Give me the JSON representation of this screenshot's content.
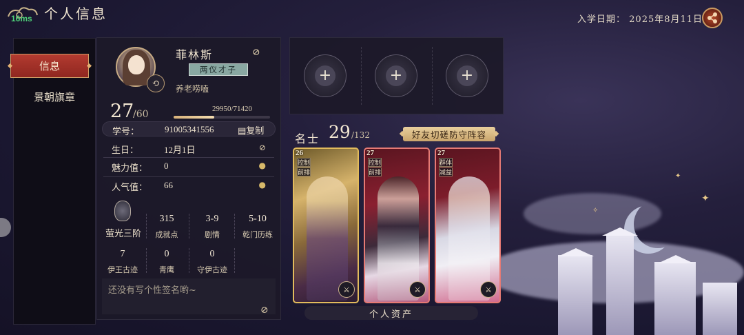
{
  "header": {
    "title": "个人信息",
    "watermark": "16ms",
    "enroll_label": "入学日期：",
    "enroll_date": "2025年8月11日"
  },
  "nav": {
    "items": [
      {
        "label": "信息",
        "active": true
      },
      {
        "label": "景朝旗章",
        "active": false
      }
    ]
  },
  "profile": {
    "name": "菲林斯",
    "title_badge": "两仪才子",
    "tag": "养老唠嗑",
    "level": "27",
    "level_max": "/60",
    "exp_text": "29950/71420",
    "exp_fraction": 0.419,
    "id_label": "学号：",
    "id_value": "91005341556",
    "copy_label": "复制",
    "birthday_label": "生日：",
    "birthday_value": "12月1日",
    "charm_label": "魅力值：",
    "charm_value": "0",
    "popularity_label": "人气值：",
    "popularity_value": "66"
  },
  "stats": {
    "rank": "萤光三阶",
    "items": [
      {
        "value": "315",
        "label": "成就点"
      },
      {
        "value": "3-9",
        "label": "剧情"
      },
      {
        "value": "5-10",
        "label": "乾门历练"
      },
      {
        "value": "7",
        "label": "伊王古迹"
      },
      {
        "value": "0",
        "label": "青鹰"
      },
      {
        "value": "0",
        "label": "守伊古迹"
      }
    ]
  },
  "signature": "还没有写个性签名哟~",
  "scholars": {
    "label": "名士",
    "count": "29",
    "total": "/132",
    "friend_button": "好友切磋防守阵容",
    "cards": [
      {
        "level": "26",
        "tags": [
          "控制",
          "前排"
        ]
      },
      {
        "level": "27",
        "tags": [
          "控制",
          "前排"
        ]
      },
      {
        "level": "27",
        "tags": [
          "群体",
          "减益"
        ]
      }
    ]
  },
  "assets_button": "个人资产",
  "colors": {
    "accent_red": "#b33b30",
    "gold": "#d8b27a",
    "panel": "#1c1928"
  }
}
